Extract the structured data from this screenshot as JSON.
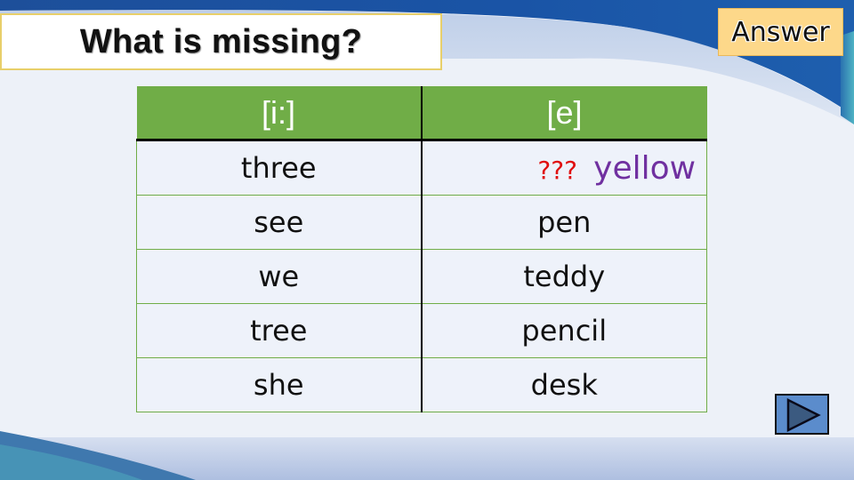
{
  "slide": {
    "title": "What is missing?",
    "answer_button": "Answer",
    "next_button_icon": "play-triangle-icon"
  },
  "table": {
    "headers": [
      "[i:]",
      "[e]"
    ],
    "rows": [
      [
        "three",
        "???"
      ],
      [
        "see",
        "pen"
      ],
      [
        "we",
        "teddy"
      ],
      [
        "tree",
        "pencil"
      ],
      [
        "she",
        "desk"
      ]
    ],
    "answer_hint": "yellow"
  },
  "colors": {
    "header_green": "#70ad47",
    "missing_red": "#e01010",
    "hint_purple": "#7030a0",
    "answer_bg": "#fdd88a",
    "next_button_blue": "#5b8ccc"
  }
}
